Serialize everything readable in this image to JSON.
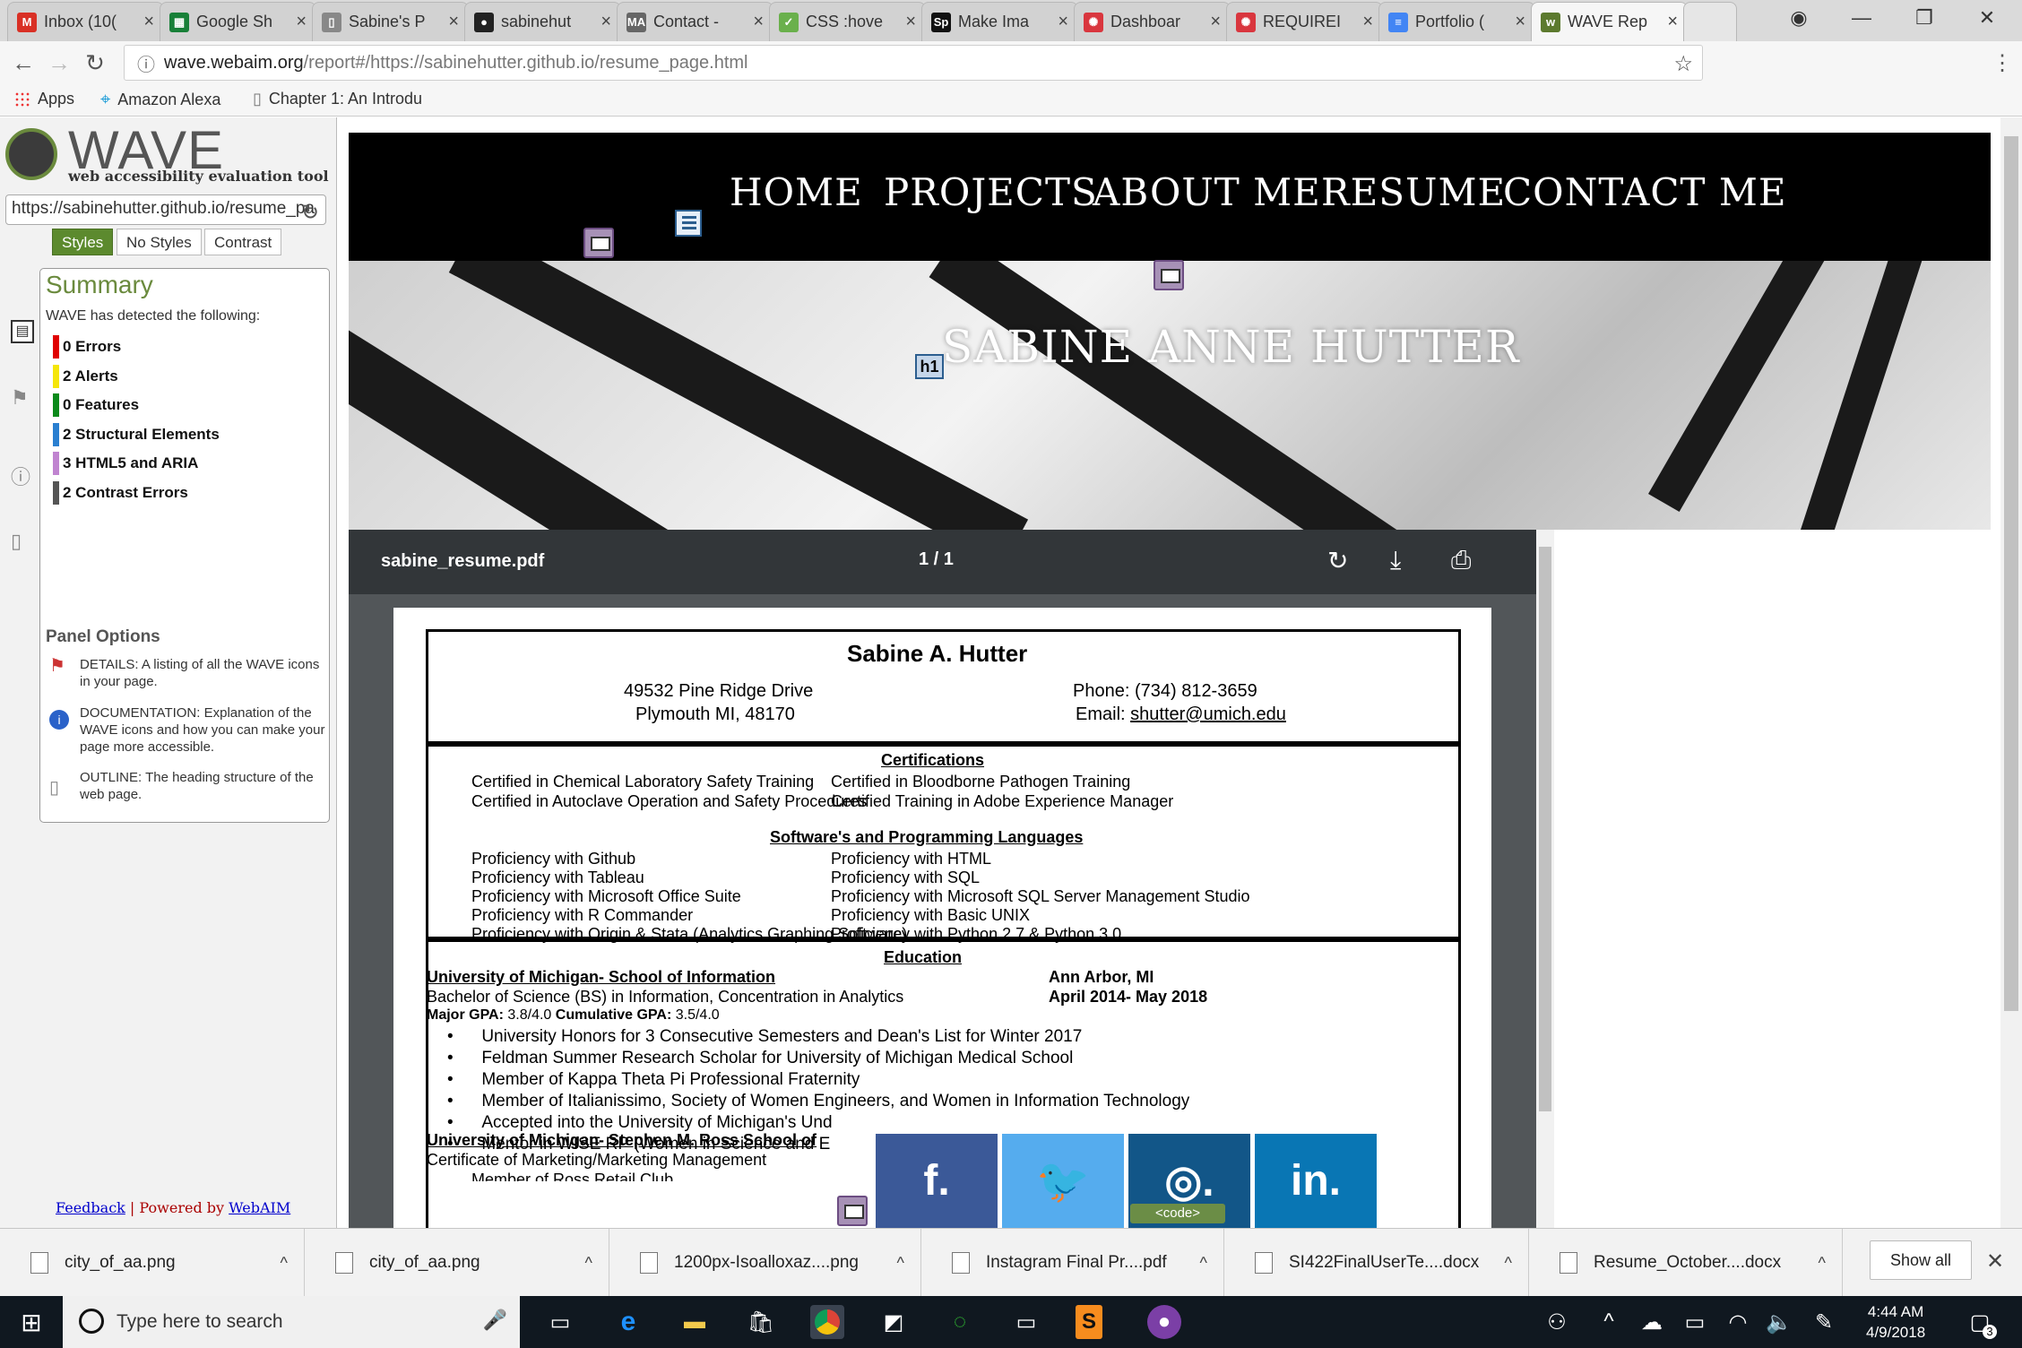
{
  "browser": {
    "tabs": [
      {
        "title": "Inbox (10(",
        "icon": "gmail-icon",
        "color": "#d93025",
        "glyph": "M"
      },
      {
        "title": "Google Sh",
        "icon": "sheets-icon",
        "color": "#188038",
        "glyph": "▦"
      },
      {
        "title": "Sabine's P",
        "icon": "page-icon",
        "color": "#888888",
        "glyph": "▯"
      },
      {
        "title": "sabinehut",
        "icon": "github-icon",
        "color": "#222222",
        "glyph": "●"
      },
      {
        "title": "Contact -",
        "icon": "ma-icon",
        "color": "#666666",
        "glyph": "MA"
      },
      {
        "title": "CSS :hove",
        "icon": "css-icon",
        "color": "#6ab04c",
        "glyph": "✓"
      },
      {
        "title": "Make Ima",
        "icon": "sp-icon",
        "color": "#111111",
        "glyph": "Sp"
      },
      {
        "title": "Dashboar",
        "icon": "canvas-icon",
        "color": "#d9363e",
        "glyph": "✺"
      },
      {
        "title": "REQUIREI",
        "icon": "canvas-icon",
        "color": "#d9363e",
        "glyph": "✺"
      },
      {
        "title": "Portfolio (",
        "icon": "docs-icon",
        "color": "#4285f4",
        "glyph": "≡"
      },
      {
        "title": "WAVE Rep",
        "icon": "wave-icon",
        "color": "#5c7a2e",
        "glyph": "w"
      }
    ],
    "url_host": "wave.webaim.org",
    "url_path": "/report#/https://sabinehutter.github.io/resume_page.html",
    "bookmarks": [
      "Apps",
      "Amazon Alexa",
      "Chapter 1: An Introdu"
    ]
  },
  "wave": {
    "title": "WAVE",
    "subtitle": "web accessibility evaluation tool",
    "url_field": "https://sabinehutter.github.io/resume_pa",
    "view_buttons": [
      "Styles",
      "No Styles",
      "Contrast"
    ],
    "summary_title": "Summary",
    "detected_text": "WAVE has detected the following:",
    "summary": [
      {
        "label": "0 Errors",
        "color": "#e00000"
      },
      {
        "label": "2 Alerts",
        "color": "#f5e60a"
      },
      {
        "label": "0 Features",
        "color": "#0a8a1a"
      },
      {
        "label": "2 Structural Elements",
        "color": "#2a7fd0"
      },
      {
        "label": "3 HTML5 and ARIA",
        "color": "#c084d0"
      },
      {
        "label": "2 Contrast Errors",
        "color": "#555555"
      }
    ],
    "panel_options_title": "Panel Options",
    "panel_options": [
      {
        "text": "DETAILS: A listing of all the WAVE icons in your page.",
        "icon": "flag-icon"
      },
      {
        "text": "DOCUMENTATION: Explanation of the WAVE icons and how you can make your page more accessible.",
        "icon": "info-icon"
      },
      {
        "text": "OUTLINE: The heading structure of the web page.",
        "icon": "outline-icon"
      }
    ],
    "feedback": "Feedback",
    "powered_by": "Powered by",
    "webaim": "WebAIM"
  },
  "site": {
    "nav": [
      "HOME",
      "PROJECTS",
      "ABOUT ME",
      "RESUME",
      "CONTACT ME"
    ],
    "hero_name": "SABINE ANNE HUTTER",
    "h1_tag": "h1"
  },
  "pdf": {
    "filename": "sabine_resume.pdf",
    "page_indicator": "1  /  1"
  },
  "resume": {
    "name": "Sabine A. Hutter",
    "address1": "49532 Pine Ridge Drive",
    "address2": "Plymouth MI, 48170",
    "phone": "Phone: (734) 812-3659",
    "email_label": "Email:",
    "email": "shutter@umich.edu",
    "cert_title": "Certifications",
    "certs_left": [
      "Certified in Chemical Laboratory Safety Training",
      "Certified in Autoclave Operation and Safety Procedures"
    ],
    "certs_right": [
      "Certified in Bloodborne Pathogen Training",
      "Certified Training in Adobe Experience Manager"
    ],
    "skills_title": "Software's and Programming Languages",
    "skills_left": [
      "Proficiency with Github",
      "Proficiency with Tableau",
      "Proficiency with Microsoft Office Suite",
      "Proficiency with R Commander",
      "Proficiency with Origin & Stata (Analytics Graphing Software)"
    ],
    "skills_right": [
      "Proficiency with HTML",
      "Proficiency with SQL",
      "Proficiency with Microsoft SQL Server Management Studio",
      "Proficiency with Basic UNIX",
      "Proficiency with Python 2.7 & Python 3.0"
    ],
    "edu_title": "Education",
    "school": "University of Michigan- School of Information",
    "location": "Ann Arbor, MI",
    "degree": "Bachelor of Science (BS) in Information, Concentration in Analytics",
    "dates": "April 2014- May 2018",
    "gpa_major_label": "Major GPA:",
    "gpa_major": "3.8/4.0",
    "gpa_cum_label": "Cumulative GPA:",
    "gpa_cum": "3.5/4.0",
    "bullets": [
      "University Honors for 3 Consecutive Semesters and Dean's List for Winter 2017",
      "Feldman Summer Research Scholar for University of Michigan Medical School",
      "Member of Kappa Theta Pi Professional Fraternity",
      "Member of Italianissimo, Society of Women Engineers, and Women in Information Technology",
      "Accepted into the University of Michigan's Und",
      "Mentor in WISE RP (Women in Science and E"
    ],
    "school2": "University of Michigan- Stephen M. Ross School of",
    "cert_mm": "Certificate of Marketing/Marketing Management",
    "member_partial": "Member of Ross Retail Club"
  },
  "social": [
    {
      "label": "f.",
      "icon": "facebook-icon",
      "color": "#3b5998"
    },
    {
      "label": "🐦",
      "icon": "twitter-icon",
      "color": "#55acee"
    },
    {
      "label": "◎.",
      "icon": "instagram-icon",
      "color": "#125688"
    },
    {
      "label": "in.",
      "icon": "linkedin-icon",
      "color": "#0976b4"
    }
  ],
  "code_tag": "<code>",
  "downloads": [
    {
      "name": "city_of_aa.png",
      "icon": "image-file-icon"
    },
    {
      "name": "city_of_aa.png",
      "icon": "image-file-icon"
    },
    {
      "name": "1200px-Isoalloxaz....png",
      "icon": "image-file-icon"
    },
    {
      "name": "Instagram Final Pr....pdf",
      "icon": "pdf-file-icon"
    },
    {
      "name": "SI422FinalUserTe....docx",
      "icon": "word-file-icon"
    },
    {
      "name": "Resume_October....docx",
      "icon": "word-file-icon"
    }
  ],
  "show_all": "Show all",
  "taskbar": {
    "search_placeholder": "Type here to search",
    "time": "4:44 AM",
    "date": "4/9/2018",
    "notification_count": "3"
  }
}
